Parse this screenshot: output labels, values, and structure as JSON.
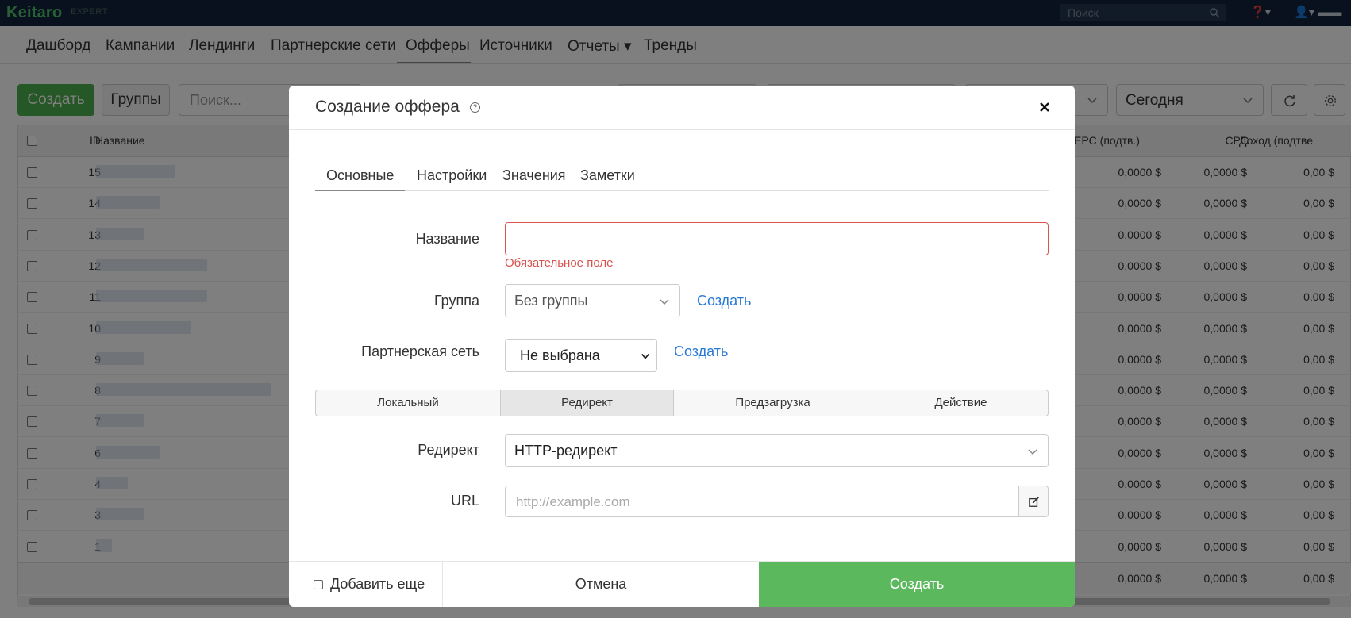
{
  "app": {
    "logo": "Keitaro",
    "edition": "EXPERT",
    "search_placeholder": "Поиск"
  },
  "nav": {
    "items": [
      {
        "label": "Дашборд"
      },
      {
        "label": "Кампании"
      },
      {
        "label": "Лендинги"
      },
      {
        "label": "Партнерские сети"
      },
      {
        "label": "Офферы",
        "active": true
      },
      {
        "label": "Источники"
      },
      {
        "label": "Отчеты ▾"
      },
      {
        "label": "Тренды"
      }
    ]
  },
  "toolbar": {
    "create_label": "Создать",
    "groups_label": "Группы",
    "search_placeholder": "Поиск...",
    "date_range": "Сегодня"
  },
  "table": {
    "headers": {
      "id": "ID",
      "name": "Название",
      "epc": "EPC (подтв.)",
      "cpc": "CPC",
      "revenue": "Доход (подтве"
    },
    "rows": [
      {
        "id": "15",
        "epc": "0,0000 $",
        "cpc": "0,0000 $",
        "revenue": "0,00 $"
      },
      {
        "id": "14",
        "epc": "0,0000 $",
        "cpc": "0,0000 $",
        "revenue": "0,00 $"
      },
      {
        "id": "13",
        "epc": "0,0000 $",
        "cpc": "0,0000 $",
        "revenue": "0,00 $"
      },
      {
        "id": "12",
        "epc": "0,0000 $",
        "cpc": "0,0000 $",
        "revenue": "0,00 $"
      },
      {
        "id": "11",
        "epc": "0,0000 $",
        "cpc": "0,0000 $",
        "revenue": "0,00 $"
      },
      {
        "id": "10",
        "epc": "0,0000 $",
        "cpc": "0,0000 $",
        "revenue": "0,00 $"
      },
      {
        "id": "9",
        "epc": "0,0000 $",
        "cpc": "0,0000 $",
        "revenue": "0,00 $"
      },
      {
        "id": "8",
        "epc": "0,0000 $",
        "cpc": "0,0000 $",
        "revenue": "0,00 $"
      },
      {
        "id": "7",
        "epc": "0,0000 $",
        "cpc": "0,0000 $",
        "revenue": "0,00 $"
      },
      {
        "id": "6",
        "epc": "0,0000 $",
        "cpc": "0,0000 $",
        "revenue": "0,00 $"
      },
      {
        "id": "4",
        "epc": "0,0000 $",
        "cpc": "0,0000 $",
        "revenue": "0,00 $"
      },
      {
        "id": "3",
        "epc": "0,0000 $",
        "cpc": "0,0000 $",
        "revenue": "0,00 $"
      },
      {
        "id": "1",
        "epc": "0,0000 $",
        "cpc": "0,0000 $",
        "revenue": "0,00 $"
      }
    ],
    "totals": {
      "epc": "0,0000 $",
      "cpc": "0,0000 $",
      "revenue": "0,00 $"
    }
  },
  "modal": {
    "title": "Создание оффера",
    "help_glyph": "?",
    "tabs": [
      {
        "label": "Основные",
        "active": true
      },
      {
        "label": "Настройки"
      },
      {
        "label": "Значения"
      },
      {
        "label": "Заметки"
      }
    ],
    "fields": {
      "name_label": "Название",
      "name_value": "",
      "name_error": "Обязательное поле",
      "group_label": "Группа",
      "group_value": "Без группы",
      "group_create": "Создать",
      "network_label": "Партнерская сеть",
      "network_value": "Не выбрана",
      "network_create": "Создать",
      "redirect_label": "Редирект",
      "redirect_value": "HTTP-редирект",
      "url_label": "URL",
      "url_placeholder": "http://example.com"
    },
    "offer_types": [
      {
        "label": "Локальный"
      },
      {
        "label": "Редирект",
        "active": true
      },
      {
        "label": "Предзагрузка"
      },
      {
        "label": "Действие"
      }
    ],
    "footer": {
      "add_more": "Добавить еще",
      "cancel": "Отмена",
      "submit": "Создать"
    }
  },
  "colors": {
    "accent_green": "#5cb85c",
    "error_red": "#d9534f",
    "link_blue": "#2a7ad5",
    "topbar": "#11233a"
  }
}
